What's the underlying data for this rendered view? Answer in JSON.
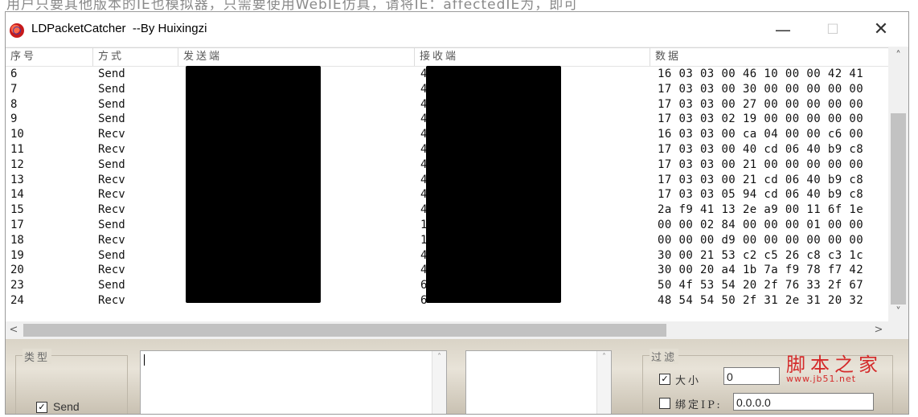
{
  "background_caption": "用户只要其他版本的IE也模拟器，只需要使用WebIE仿真，请将IE：affectedIE为，即可",
  "window": {
    "title": "LDPacketCatcher  --By Huixingzi",
    "controls": {
      "minimize": "—",
      "maximize": "☐",
      "close": "✕"
    }
  },
  "table": {
    "columns": [
      "序号",
      "方式",
      "发送端",
      "接收端",
      "数据"
    ],
    "rows": [
      {
        "id": "6",
        "method": "Send",
        "sender": "",
        "receiver": "4",
        "data": "16 03 03 00 46 10 00 00 42 41"
      },
      {
        "id": "7",
        "method": "Send",
        "sender": "",
        "receiver": "4",
        "data": "17 03 03 00 30 00 00 00 00 00"
      },
      {
        "id": "8",
        "method": "Send",
        "sender": "",
        "receiver": "4",
        "data": "17 03 03 00 27 00 00 00 00 00"
      },
      {
        "id": "9",
        "method": "Send",
        "sender": "",
        "receiver": "4",
        "data": "17 03 03 02 19 00 00 00 00 00"
      },
      {
        "id": "10",
        "method": "Recv",
        "sender": "",
        "receiver": "4",
        "data": "16 03 03 00 ca 04 00 00 c6 00"
      },
      {
        "id": "11",
        "method": "Recv",
        "sender": "",
        "receiver": "4",
        "data": "17 03 03 00 40 cd 06 40 b9 c8"
      },
      {
        "id": "12",
        "method": "Send",
        "sender": "",
        "receiver": "4",
        "data": "17 03 03 00 21 00 00 00 00 00"
      },
      {
        "id": "13",
        "method": "Recv",
        "sender": "",
        "receiver": "4",
        "data": "17 03 03 00 21 cd 06 40 b9 c8"
      },
      {
        "id": "14",
        "method": "Recv",
        "sender": "",
        "receiver": "4",
        "data": "17 03 03 05 94 cd 06 40 b9 c8"
      },
      {
        "id": "15",
        "method": "Recv",
        "sender": "",
        "receiver": "4",
        "data": "2a f9 41 13 2e a9 00 11 6f 1e"
      },
      {
        "id": "17",
        "method": "Send",
        "sender": "",
        "receiver": "1",
        "data": "00 00 02 84 00 00 00 01 00 00"
      },
      {
        "id": "18",
        "method": "Recv",
        "sender": "",
        "receiver": "1",
        "data": "00 00 00 d9 00 00 00 00 00 00"
      },
      {
        "id": "19",
        "method": "Send",
        "sender": "",
        "receiver": "4",
        "data": "30 00 21 53 c2 c5 26 c8 c3 1c"
      },
      {
        "id": "20",
        "method": "Recv",
        "sender": "",
        "receiver": "4",
        "data": "30 00 20 a4 1b 7a f9 78 f7 42"
      },
      {
        "id": "23",
        "method": "Send",
        "sender": "",
        "receiver": "6",
        "data": "50 4f 53 54 20 2f 76 33 2f 67"
      },
      {
        "id": "24",
        "method": "Recv",
        "sender": "",
        "receiver": "6",
        "data": "48 54 54 50 2f 31 2e 31 20 32"
      }
    ]
  },
  "scroll": {
    "up": "˄",
    "down": "˅",
    "left": "<",
    "right": ">"
  },
  "bottom": {
    "type_group_label": "类型",
    "send_checkbox": {
      "label": "Send",
      "checked": true
    },
    "filter_group_label": "过滤",
    "size_checkbox": {
      "label": "大小",
      "checked": true
    },
    "size_value": "0",
    "ip_checkbox": {
      "label": "绑定IP:",
      "checked": false
    },
    "ip_value": "0.0.0.0"
  },
  "watermark": {
    "text": "脚本之家",
    "url": "www.jb51.net"
  }
}
